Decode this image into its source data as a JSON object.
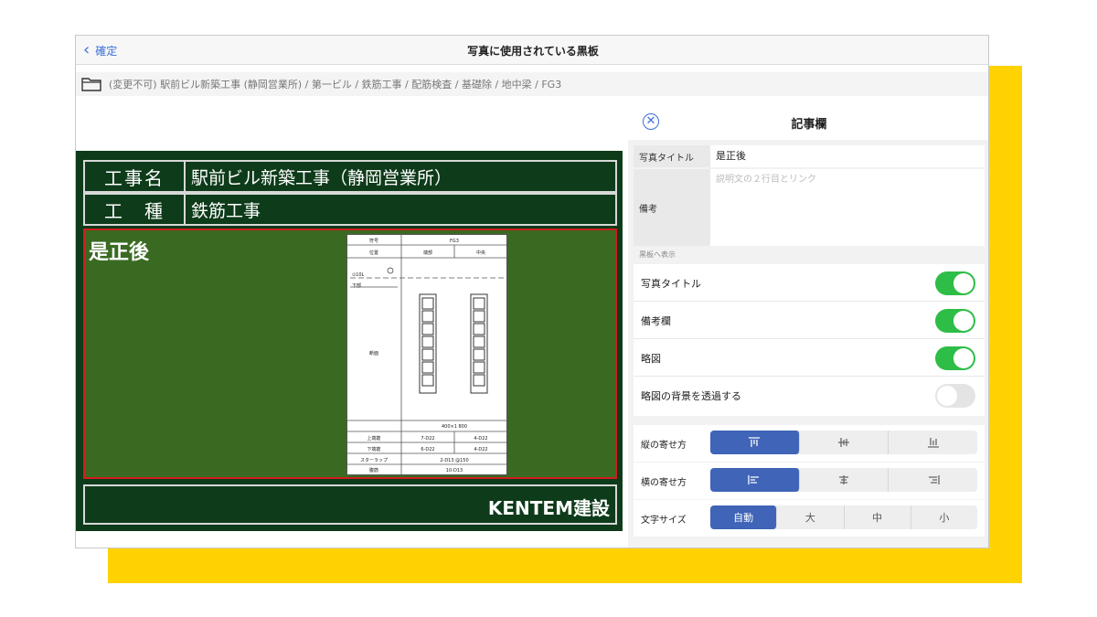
{
  "nav": {
    "back_label": "確定",
    "title": "写真に使用されている黒板"
  },
  "breadcrumb": {
    "path": "(変更不可) 駅前ビル新築工事 (静岡営業所) / 第一ビル / 鉄筋工事 / 配筋検査 / 基礎除 / 地中梁 / FG3"
  },
  "board": {
    "rows": [
      {
        "label": "工事名",
        "value": "駅前ビル新築工事（静岡営業所）"
      },
      {
        "label": "工　種",
        "value": "鉄筋工事"
      }
    ],
    "photo_title": "是正後",
    "company": "KENTEM建設",
    "sketch": {
      "header": [
        "符号",
        "FG3"
      ],
      "position_row": [
        "位置",
        "端部",
        "中央"
      ],
      "side_label": "断面",
      "dims": "400×1 800",
      "rows": [
        [
          "上端筋",
          "7-D22",
          "4-D22"
        ],
        [
          "下端筋",
          "6-D22",
          "4-D22"
        ],
        [
          "スターラップ",
          "2-D13 @150"
        ],
        [
          "腹筋",
          "10-D13"
        ]
      ],
      "marks": [
        "⊙10L",
        "下部",
        "筋"
      ]
    }
  },
  "panel": {
    "title": "記事欄",
    "photo_title_label": "写真タイトル",
    "photo_title_value": "是正後",
    "remarks_label": "備考",
    "remarks_placeholder": "説明文の２行目とリンク",
    "section_caption": "黒板へ表示",
    "toggles": [
      {
        "label": "写真タイトル",
        "on": true
      },
      {
        "label": "備考欄",
        "on": true
      },
      {
        "label": "略図",
        "on": true
      },
      {
        "label": "略図の背景を透過する",
        "on": false
      }
    ],
    "vertical_align": {
      "label": "縦の寄せ方",
      "options": [
        "top-align-icon",
        "middle-align-icon",
        "bottom-align-icon"
      ],
      "selected": 0
    },
    "horizontal_align": {
      "label": "横の寄せ方",
      "options": [
        "left-align-icon",
        "center-align-icon",
        "right-align-icon"
      ],
      "selected": 0
    },
    "font_size": {
      "label": "文字サイズ",
      "options": [
        "自動",
        "大",
        "中",
        "小"
      ],
      "selected": 0
    }
  },
  "colors": {
    "accent": "#3f64b8",
    "toggle_on": "#2ebd47",
    "board": "#0e3b1a",
    "photo": "#3a6a22",
    "highlight": "#d11d1d",
    "backdrop": "#FFD200"
  }
}
